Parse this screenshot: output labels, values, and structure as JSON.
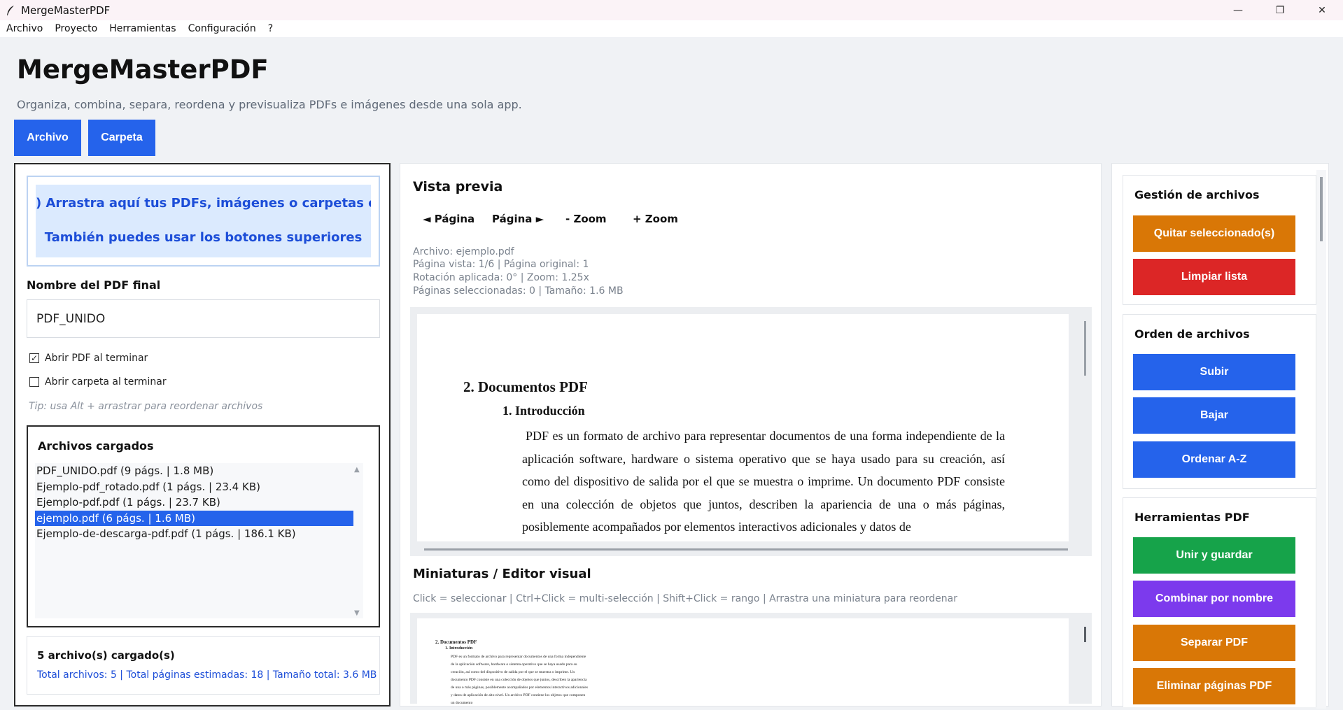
{
  "window": {
    "title": "MergeMasterPDF",
    "controls": {
      "minimize": "—",
      "maximize": "❐",
      "close": "✕"
    }
  },
  "menu": [
    "Archivo",
    "Proyecto",
    "Herramientas",
    "Configuración",
    "?"
  ],
  "header": {
    "title": "MergeMasterPDF",
    "subtitle": "Organiza, combina, separa, reordena y previsualiza PDFs e imágenes desde una sola app."
  },
  "top_buttons": {
    "file": "Archivo",
    "folder": "Carpeta"
  },
  "left": {
    "dropzone": {
      "line1": ") Arrastra aquí tus PDFs, imágenes o carpetas complet",
      "line2": "También puedes usar los botones superiores"
    },
    "output_name_label": "Nombre del PDF final",
    "output_name_value": "PDF_UNIDO",
    "open_pdf": {
      "label": "Abrir PDF al terminar",
      "checked": true,
      "mark": "✓"
    },
    "open_folder": {
      "label": "Abrir carpeta al terminar",
      "checked": false,
      "mark": ""
    },
    "tip": "Tip: usa Alt + arrastrar para reordenar archivos",
    "files_title": "Archivos cargados",
    "files": [
      {
        "text": "PDF_UNIDO.pdf (9 págs. | 1.8 MB)",
        "selected": false
      },
      {
        "text": "Ejemplo-pdf_rotado.pdf (1 págs. | 23.4 KB)",
        "selected": false
      },
      {
        "text": "Ejemplo-pdf.pdf (1 págs. | 23.7 KB)",
        "selected": false
      },
      {
        "text": "ejemplo.pdf (6 págs. | 1.6 MB)",
        "selected": true
      },
      {
        "text": "Ejemplo-de-descarga-pdf.pdf (1 págs. | 186.1 KB)",
        "selected": false
      }
    ],
    "summary_title": "5 archivo(s) cargado(s)",
    "summary_detail": "Total archivos: 5 | Total páginas estimadas: 18 | Tamaño total: 3.6 MB"
  },
  "center": {
    "preview_title": "Vista previa",
    "nav": {
      "prev": "◄ Página",
      "next": "Página ►",
      "zoom_out": "- Zoom",
      "zoom_in": "+ Zoom"
    },
    "info": [
      "Archivo: ejemplo.pdf",
      "Página vista: 1/6 | Página original: 1",
      "Rotación aplicada: 0° | Zoom: 1.25x",
      "Páginas seleccionadas: 0 | Tamaño: 1.6 MB"
    ],
    "document": {
      "h2": "2.  Documentos PDF",
      "h3": "1.   Introducción",
      "paragraph": "PDF es un formato de archivo para representar documentos de una forma independiente de la aplicación software, hardware o sistema operativo que se haya usado para su creación, así como del dispositivo de salida por el que se muestra o imprime. Un documento PDF consiste en una colección de objetos que juntos, describen la apariencia de una o más páginas, posiblemente acompañados por elementos interactivos adicionales y datos de"
    },
    "thumbs_title": "Miniaturas / Editor visual",
    "thumbs_hint": "Click = seleccionar | Ctrl+Click = multi-selección | Shift+Click = rango | Arrastra una miniatura para reordenar",
    "thumb": {
      "h2": "2. Documentos PDF",
      "h3": "1. Introducción",
      "paragraph": "PDF es un formato de archivo para representar documentos de una forma independiente de la aplicación software, hardware o sistema operativo que se haya usado para su creación, así como del dispositivo de salida por el que se muestra o imprime. Un documento PDF consiste en una colección de objetos que juntos, describen la apariencia de una o más páginas, posiblemente acompañados por elementos interactivos adicionales y datos de aplicación de alto nivel. Un archivo PDF contiene los objetos que componen un documento"
    }
  },
  "right": {
    "file_management": {
      "title": "Gestión de archivos",
      "remove_selected": "Quitar seleccionado(s)",
      "clear_list": "Limpiar lista"
    },
    "file_order": {
      "title": "Orden de archivos",
      "up": "Subir",
      "down": "Bajar",
      "sort_az": "Ordenar A-Z"
    },
    "pdf_tools": {
      "title": "Herramientas PDF",
      "merge_save": "Unir y guardar",
      "combine_by_name": "Combinar por nombre",
      "split": "Separar PDF",
      "delete_pages": "Eliminar páginas PDF"
    }
  },
  "colors": {
    "primary": "#2563eb",
    "orange": "#d97706",
    "red": "#dc2626",
    "green": "#16a34a",
    "purple": "#7c3aed",
    "dropzone_bg": "#dbeafe",
    "dropzone_text": "#1d4ed8"
  }
}
